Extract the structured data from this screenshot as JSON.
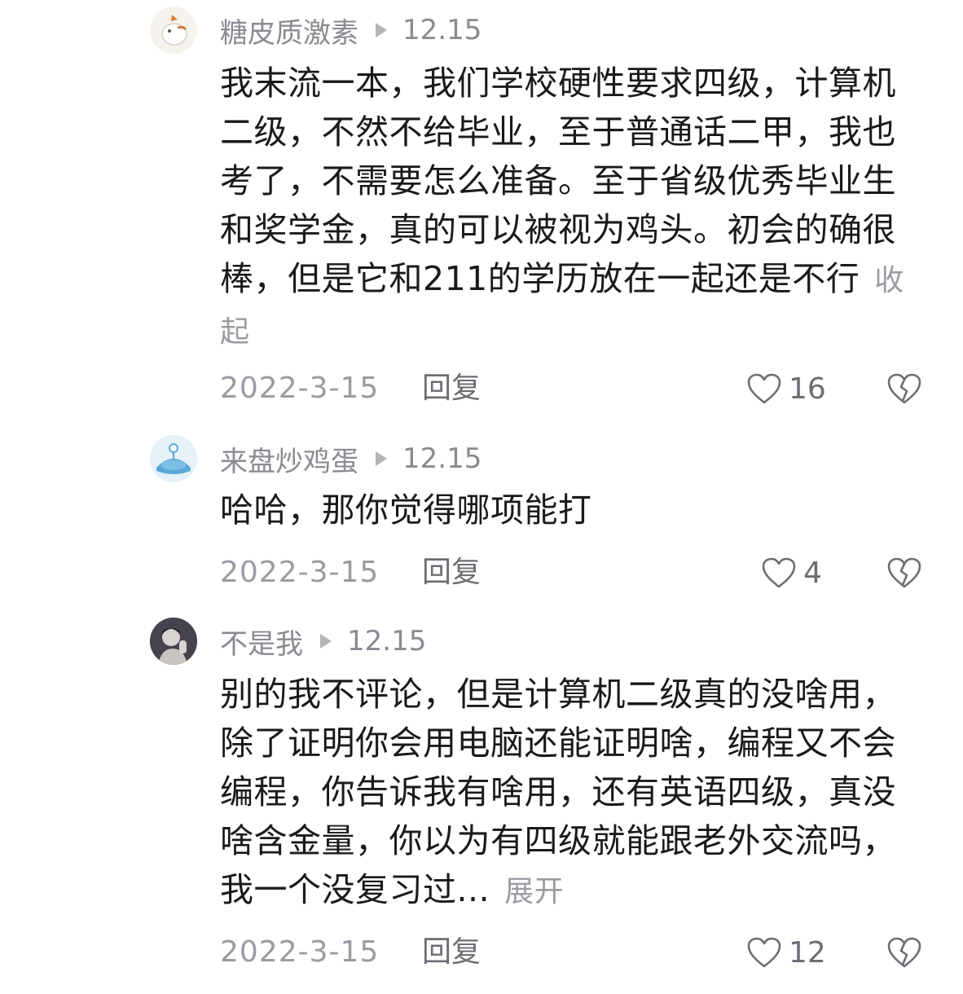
{
  "comments": [
    {
      "username": "糖皮质激素",
      "reply_time": "12.15",
      "text": "我末流一本，我们学校硬性要求四级，计算机二级，不然不给毕业，至于普通话二甲，我也考了，不需要怎么准备。至于省级优秀毕业生和奖学金，真的可以被视为鸡头。初会的确很棒，但是它和211的学历放在一起还是不行",
      "toggle_label": "收起",
      "date": "2022-3-15",
      "reply_label": "回复",
      "likes": "16"
    },
    {
      "username": "来盘炒鸡蛋",
      "reply_time": "12.15",
      "text": "哈哈，那你觉得哪项能打",
      "toggle_label": "",
      "date": "2022-3-15",
      "reply_label": "回复",
      "likes": "4"
    },
    {
      "username": "不是我",
      "reply_time": "12.15",
      "text": "别的我不评论，但是计算机二级真的没啥用，除了证明你会用电脑还能证明啥，编程又不会编程，你告诉我有啥用，还有英语四级，真没啥含金量，你以为有四级就能跟老外交流吗，我一个没复习过...",
      "toggle_label": "展开",
      "date": "2022-3-15",
      "reply_label": "回复",
      "likes": "12"
    }
  ],
  "icons": {
    "like": "heart-outline-icon",
    "dislike": "broken-heart-icon",
    "reply_indicator": "play-triangle-icon"
  },
  "colors": {
    "text": "#1a1a1a",
    "muted": "#9b9ba3",
    "icon": "#6d6d75"
  }
}
